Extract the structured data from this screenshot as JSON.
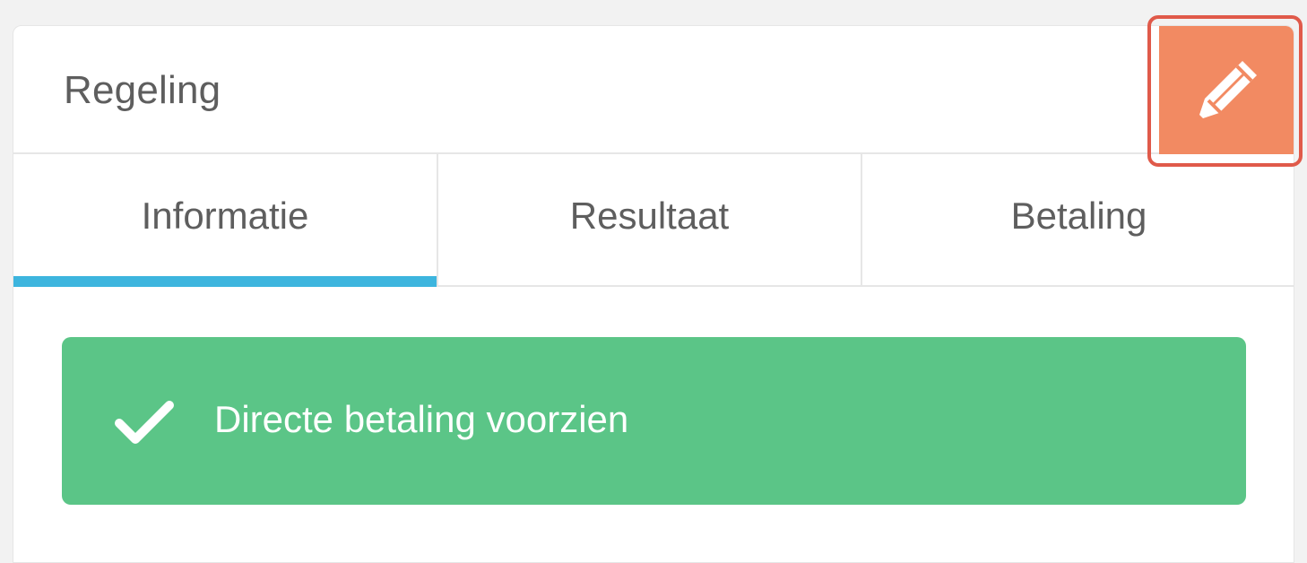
{
  "card": {
    "title": "Regeling"
  },
  "toolbar": {
    "edit_icon": "pencil-icon"
  },
  "tabs": [
    {
      "label": "Informatie",
      "active": true
    },
    {
      "label": "Resultaat",
      "active": false
    },
    {
      "label": "Betaling",
      "active": false
    }
  ],
  "alert": {
    "icon": "check-icon",
    "message": "Directe betaling voorzien"
  },
  "colors": {
    "accent_tab": "#3db5de",
    "edit_button": "#f28a62",
    "edit_highlight": "#e05a4a",
    "success": "#5bc587",
    "text": "#5e5e5e"
  }
}
